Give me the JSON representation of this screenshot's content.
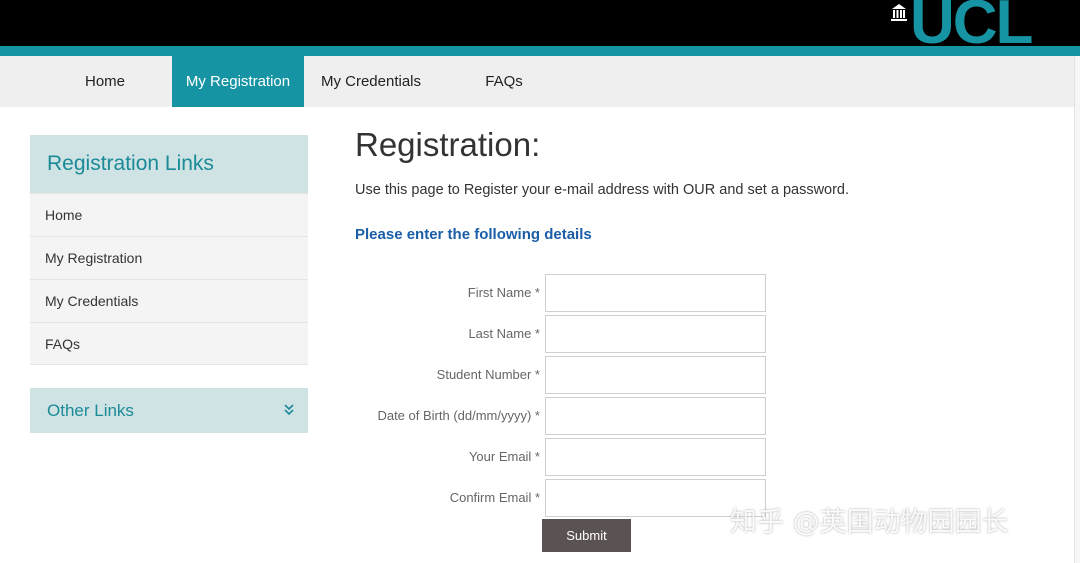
{
  "brand": {
    "logo_text": "UCL",
    "accent": "#1694a3",
    "header_bg": "#000000"
  },
  "nav": {
    "items": [
      {
        "label": "Home",
        "active": false
      },
      {
        "label": "My Registration",
        "active": true
      },
      {
        "label": "My Credentials",
        "active": false
      },
      {
        "label": "FAQs",
        "active": false
      }
    ]
  },
  "sidebar": {
    "heading": "Registration Links",
    "items": [
      {
        "label": "Home"
      },
      {
        "label": "My Registration"
      },
      {
        "label": "My Credentials"
      },
      {
        "label": "FAQs"
      }
    ],
    "other_links": {
      "label": "Other Links",
      "icon": "chevron-double-down-icon"
    }
  },
  "main": {
    "title": "Registration:",
    "intro": "Use this page to Register your e-mail address with OUR and set a password.",
    "subhead": "Please enter the following details"
  },
  "form": {
    "fields": [
      {
        "label": "First Name *",
        "value": ""
      },
      {
        "label": "Last Name *",
        "value": ""
      },
      {
        "label": "Student Number *",
        "value": ""
      },
      {
        "label": "Date of Birth (dd/mm/yyyy) *",
        "value": ""
      },
      {
        "label": "Your Email *",
        "value": ""
      },
      {
        "label": "Confirm Email *",
        "value": ""
      }
    ],
    "submit_label": "Submit"
  },
  "watermark": {
    "text": "知乎 @英国动物园园长"
  }
}
